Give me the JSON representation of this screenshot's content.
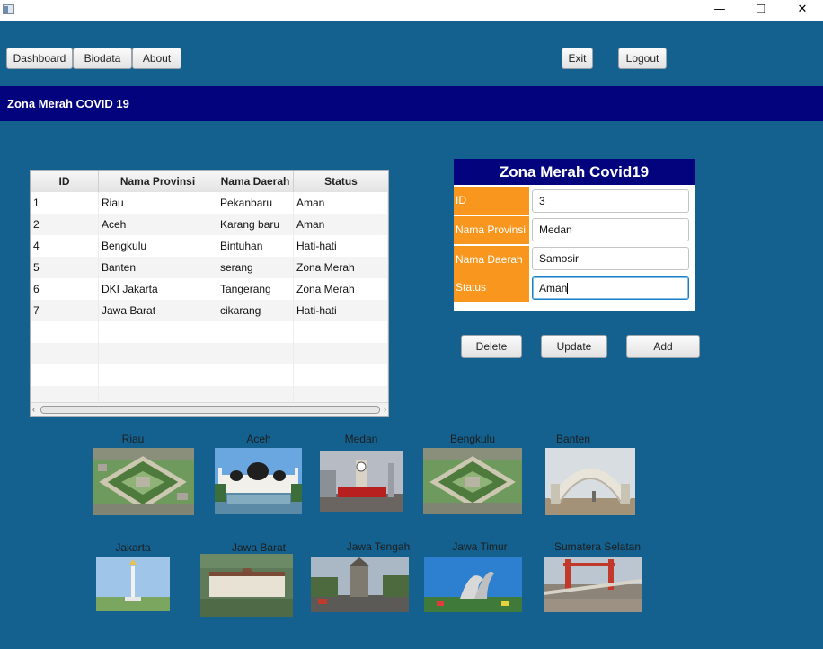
{
  "window": {
    "minimize_glyph": "—",
    "maximize_glyph": "❐",
    "close_glyph": "✕"
  },
  "nav": {
    "dashboard": "Dashboard",
    "biodata": "Biodata",
    "about": "About",
    "exit": "Exit",
    "logout": "Logout"
  },
  "header": {
    "title": "Zona Merah COVID 19"
  },
  "table": {
    "columns": [
      "ID",
      "Nama Provinsi",
      "Nama Daerah",
      "Status"
    ],
    "rows": [
      [
        "1",
        "Riau",
        "Pekanbaru",
        "Aman"
      ],
      [
        "2",
        "Aceh",
        "Karang baru",
        "Aman"
      ],
      [
        "4",
        "Bengkulu",
        "Bintuhan",
        "Hati-hati"
      ],
      [
        "5",
        "Banten",
        "serang",
        "Zona Merah"
      ],
      [
        "6",
        "DKI Jakarta",
        "Tangerang",
        "Zona Merah"
      ],
      [
        "7",
        "Jawa Barat",
        "cikarang",
        "Hati-hati"
      ]
    ]
  },
  "form": {
    "title": "Zona Merah Covid19",
    "id_label": "ID",
    "id_value": "3",
    "provinsi_label": "Nama Provinsi",
    "provinsi_value": "Medan",
    "daerah_label": "Nama Daerah",
    "daerah_value": "Samosir",
    "status_label": "Status",
    "status_value": "Aman"
  },
  "actions": {
    "delete": "Delete",
    "update": "Update",
    "add": "Add"
  },
  "gallery": {
    "row1": [
      "Riau",
      "Aceh",
      "Medan",
      "Bengkulu",
      "Banten"
    ],
    "row2": [
      "Jakarta",
      "Jawa Barat",
      "Jawa Tengah",
      "Jawa Timur",
      "Sumatera Selatan"
    ]
  },
  "colors": {
    "background": "#14618f",
    "header_bar": "#03037d",
    "form_label": "#f8961e"
  }
}
